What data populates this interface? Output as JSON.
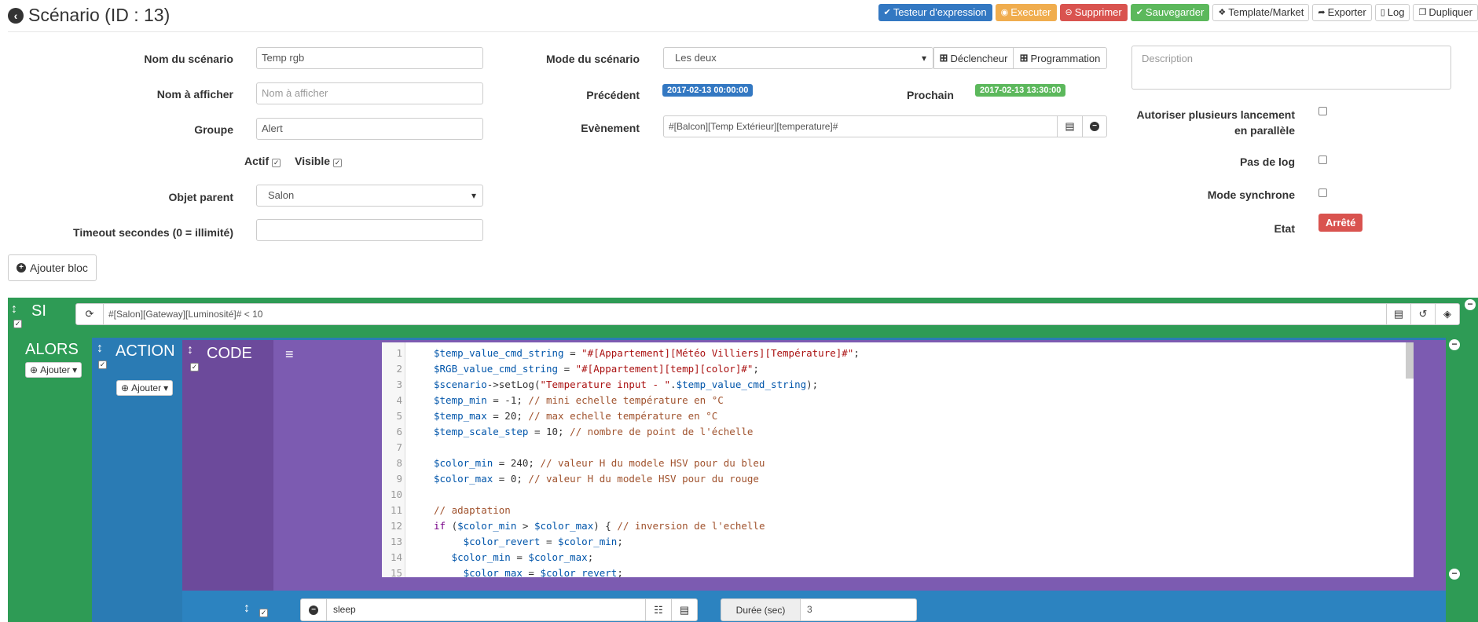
{
  "header": {
    "title": "Scénario (ID : 13)",
    "buttons": {
      "testeur": "Testeur d'expression",
      "executer": "Executer",
      "supprimer": "Supprimer",
      "sauvegarder": "Sauvegarder",
      "template": "Template/Market",
      "exporter": "Exporter",
      "log": "Log",
      "dupliquer": "Dupliquer"
    }
  },
  "form": {
    "nom_label": "Nom du scénario",
    "nom_value": "Temp rgb",
    "afficher_label": "Nom à afficher",
    "afficher_placeholder": "Nom à afficher",
    "groupe_label": "Groupe",
    "groupe_value": "Alert",
    "actif_label": "Actif",
    "visible_label": "Visible",
    "objet_label": "Objet parent",
    "objet_value": "Salon",
    "timeout_label": "Timeout secondes (0 = illimité)",
    "timeout_value": "",
    "mode_label": "Mode du scénario",
    "mode_value": "Les deux",
    "declencheur_label": "Déclencheur",
    "programmation_label": "Programmation",
    "precedent_label": "Précédent",
    "precedent_value": "2017-02-13 00:00:00",
    "prochain_label": "Prochain",
    "prochain_value": "2017-02-13 13:30:00",
    "evenement_label": "Evènement",
    "evenement_value": "#[Balcon][Temp Extérieur][temperature]#",
    "description_placeholder": "Description",
    "autoriser_label_1": "Autoriser plusieurs lancement",
    "autoriser_label_2": "en parallèle",
    "pas_de_log_label": "Pas de log",
    "mode_synchrone_label": "Mode synchrone",
    "etat_label": "Etat",
    "etat_value": "Arrêté",
    "ajouter_bloc": "Ajouter bloc"
  },
  "colors": {
    "green_block": "#2e9b55",
    "blue_block": "#2a7bb4",
    "purple_block": "#6c4a9b",
    "etat_red": "#d9534f"
  },
  "blocks": {
    "si_label": "SI",
    "si_condition": "#[Salon][Gateway][Luminosité]# < 10",
    "alors_label": "ALORS",
    "ajouter": "Ajouter",
    "action_label": "ACTION",
    "code_label": "CODE",
    "sleep_value": "sleep",
    "duree_label": "Durée (sec)",
    "duree_value": "3"
  },
  "code_lines": [
    [
      {
        "t": "$temp_value_cmd_string",
        "c": "v"
      },
      {
        "t": " = ",
        "c": "p"
      },
      {
        "t": "\"#[Appartement][Météo Villiers][Température]#\"",
        "c": "s"
      },
      {
        "t": ";",
        "c": "p"
      }
    ],
    [
      {
        "t": "$RGB_value_cmd_string",
        "c": "v"
      },
      {
        "t": " = ",
        "c": "p"
      },
      {
        "t": "\"#[Appartement][temp][color]#\"",
        "c": "s"
      },
      {
        "t": ";",
        "c": "p"
      }
    ],
    [
      {
        "t": "$scenario",
        "c": "v"
      },
      {
        "t": "->setLog(",
        "c": "p"
      },
      {
        "t": "\"Temperature input - \"",
        "c": "s"
      },
      {
        "t": ".",
        "c": "p"
      },
      {
        "t": "$temp_value_cmd_string",
        "c": "v"
      },
      {
        "t": ");",
        "c": "p"
      }
    ],
    [
      {
        "t": "$temp_min",
        "c": "v"
      },
      {
        "t": " = -1; ",
        "c": "p"
      },
      {
        "t": "// mini echelle température en °C",
        "c": "c"
      }
    ],
    [
      {
        "t": "$temp_max",
        "c": "v"
      },
      {
        "t": " = 20; ",
        "c": "p"
      },
      {
        "t": "// max echelle température en °C",
        "c": "c"
      }
    ],
    [
      {
        "t": "$temp_scale_step",
        "c": "v"
      },
      {
        "t": " = 10; ",
        "c": "p"
      },
      {
        "t": "// nombre de point de l'échelle",
        "c": "c"
      }
    ],
    [],
    [
      {
        "t": "$color_min",
        "c": "v"
      },
      {
        "t": " = 240; ",
        "c": "p"
      },
      {
        "t": "// valeur H du modele HSV pour du bleu",
        "c": "c"
      }
    ],
    [
      {
        "t": "$color_max",
        "c": "v"
      },
      {
        "t": " = 0; ",
        "c": "p"
      },
      {
        "t": "// valeur H du modele HSV pour du rouge",
        "c": "c"
      }
    ],
    [],
    [
      {
        "t": "// adaptation",
        "c": "c"
      }
    ],
    [
      {
        "t": "if",
        "c": "k"
      },
      {
        "t": " (",
        "c": "p"
      },
      {
        "t": "$color_min",
        "c": "v"
      },
      {
        "t": " > ",
        "c": "p"
      },
      {
        "t": "$color_max",
        "c": "v"
      },
      {
        "t": ") { ",
        "c": "p"
      },
      {
        "t": "// inversion de l'echelle",
        "c": "c"
      }
    ],
    [
      {
        "t": "     $color_revert",
        "c": "v"
      },
      {
        "t": " = ",
        "c": "p"
      },
      {
        "t": "$color_min",
        "c": "v"
      },
      {
        "t": ";",
        "c": "p"
      }
    ],
    [
      {
        "t": "   $color_min",
        "c": "v"
      },
      {
        "t": " = ",
        "c": "p"
      },
      {
        "t": "$color_max",
        "c": "v"
      },
      {
        "t": ";",
        "c": "p"
      }
    ],
    [
      {
        "t": "     $color_max",
        "c": "v"
      },
      {
        "t": " = ",
        "c": "p"
      },
      {
        "t": "$color_revert",
        "c": "v"
      },
      {
        "t": ";",
        "c": "p"
      }
    ]
  ]
}
